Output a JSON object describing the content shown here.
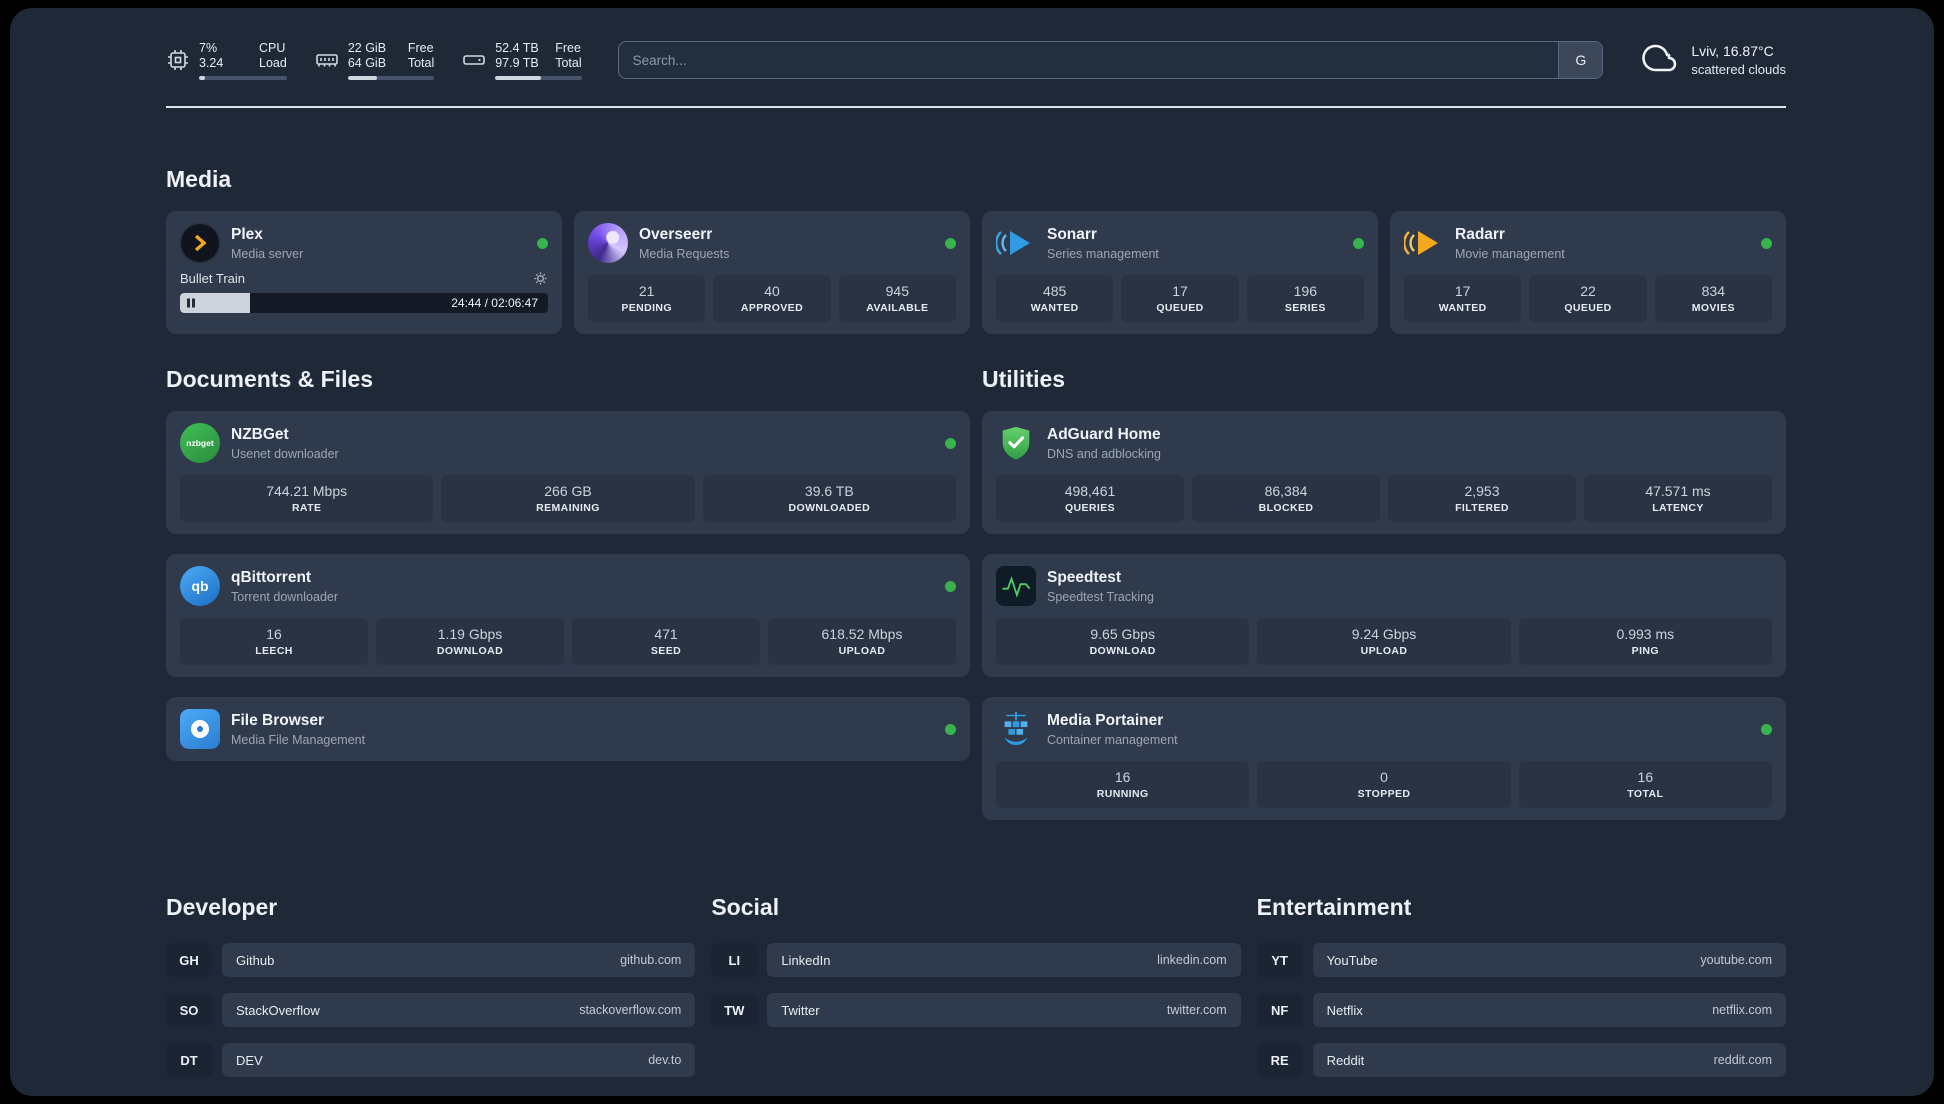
{
  "topbar": {
    "cpu": {
      "value_top": "7%",
      "value_bottom": "3.24",
      "label_top": "CPU",
      "label_bottom": "Load",
      "bar_percent": 7
    },
    "ram": {
      "value_top": "22 GiB",
      "value_bottom": "64 GiB",
      "label_top": "Free",
      "label_bottom": "Total",
      "bar_percent": 34
    },
    "disk": {
      "value_top": "52.4 TB",
      "value_bottom": "97.9 TB",
      "label_top": "Free",
      "label_bottom": "Total",
      "bar_percent": 53
    },
    "search": {
      "placeholder": "Search...",
      "engine_button": "G"
    },
    "weather": {
      "location": "Lviv, 16.87°C",
      "condition": "scattered clouds"
    }
  },
  "sections": {
    "media": {
      "title": "Media",
      "plex": {
        "name": "Plex",
        "desc": "Media server",
        "now_playing": "Bullet Train",
        "time": "24:44 / 02:06:47",
        "progress_percent": 19
      },
      "overseerr": {
        "name": "Overseerr",
        "desc": "Media Requests",
        "stats": [
          {
            "value": "21",
            "label": "PENDING"
          },
          {
            "value": "40",
            "label": "APPROVED"
          },
          {
            "value": "945",
            "label": "AVAILABLE"
          }
        ]
      },
      "sonarr": {
        "name": "Sonarr",
        "desc": "Series management",
        "stats": [
          {
            "value": "485",
            "label": "WANTED"
          },
          {
            "value": "17",
            "label": "QUEUED"
          },
          {
            "value": "196",
            "label": "SERIES"
          }
        ]
      },
      "radarr": {
        "name": "Radarr",
        "desc": "Movie management",
        "stats": [
          {
            "value": "17",
            "label": "WANTED"
          },
          {
            "value": "22",
            "label": "QUEUED"
          },
          {
            "value": "834",
            "label": "MOVIES"
          }
        ]
      }
    },
    "documents": {
      "title": "Documents & Files",
      "nzbget": {
        "name": "NZBGet",
        "desc": "Usenet downloader",
        "icon_text": "nzbget",
        "stats": [
          {
            "value": "744.21 Mbps",
            "label": "RATE"
          },
          {
            "value": "266 GB",
            "label": "REMAINING"
          },
          {
            "value": "39.6 TB",
            "label": "DOWNLOADED"
          }
        ]
      },
      "qbittorrent": {
        "name": "qBittorrent",
        "desc": "Torrent downloader",
        "icon_text": "qb",
        "stats": [
          {
            "value": "16",
            "label": "LEECH"
          },
          {
            "value": "1.19 Gbps",
            "label": "DOWNLOAD"
          },
          {
            "value": "471",
            "label": "SEED"
          },
          {
            "value": "618.52 Mbps",
            "label": "UPLOAD"
          }
        ]
      },
      "filebrowser": {
        "name": "File Browser",
        "desc": "Media File Management"
      }
    },
    "utilities": {
      "title": "Utilities",
      "adguard": {
        "name": "AdGuard Home",
        "desc": "DNS and adblocking",
        "stats": [
          {
            "value": "498,461",
            "label": "QUERIES"
          },
          {
            "value": "86,384",
            "label": "BLOCKED"
          },
          {
            "value": "2,953",
            "label": "FILTERED"
          },
          {
            "value": "47.571 ms",
            "label": "LATENCY"
          }
        ]
      },
      "speedtest": {
        "name": "Speedtest",
        "desc": "Speedtest Tracking",
        "stats": [
          {
            "value": "9.65 Gbps",
            "label": "DOWNLOAD"
          },
          {
            "value": "9.24 Gbps",
            "label": "UPLOAD"
          },
          {
            "value": "0.993 ms",
            "label": "PING"
          }
        ]
      },
      "portainer": {
        "name": "Media Portainer",
        "desc": "Container management",
        "stats": [
          {
            "value": "16",
            "label": "RUNNING"
          },
          {
            "value": "0",
            "label": "STOPPED"
          },
          {
            "value": "16",
            "label": "TOTAL"
          }
        ]
      }
    }
  },
  "bookmarks": {
    "developer": {
      "title": "Developer",
      "items": [
        {
          "abbr": "GH",
          "name": "Github",
          "url": "github.com"
        },
        {
          "abbr": "SO",
          "name": "StackOverflow",
          "url": "stackoverflow.com"
        },
        {
          "abbr": "DT",
          "name": "DEV",
          "url": "dev.to"
        }
      ]
    },
    "social": {
      "title": "Social",
      "items": [
        {
          "abbr": "LI",
          "name": "LinkedIn",
          "url": "linkedin.com"
        },
        {
          "abbr": "TW",
          "name": "Twitter",
          "url": "twitter.com"
        }
      ]
    },
    "entertainment": {
      "title": "Entertainment",
      "items": [
        {
          "abbr": "YT",
          "name": "YouTube",
          "url": "youtube.com"
        },
        {
          "abbr": "NF",
          "name": "Netflix",
          "url": "netflix.com"
        },
        {
          "abbr": "RE",
          "name": "Reddit",
          "url": "reddit.com"
        }
      ]
    }
  }
}
